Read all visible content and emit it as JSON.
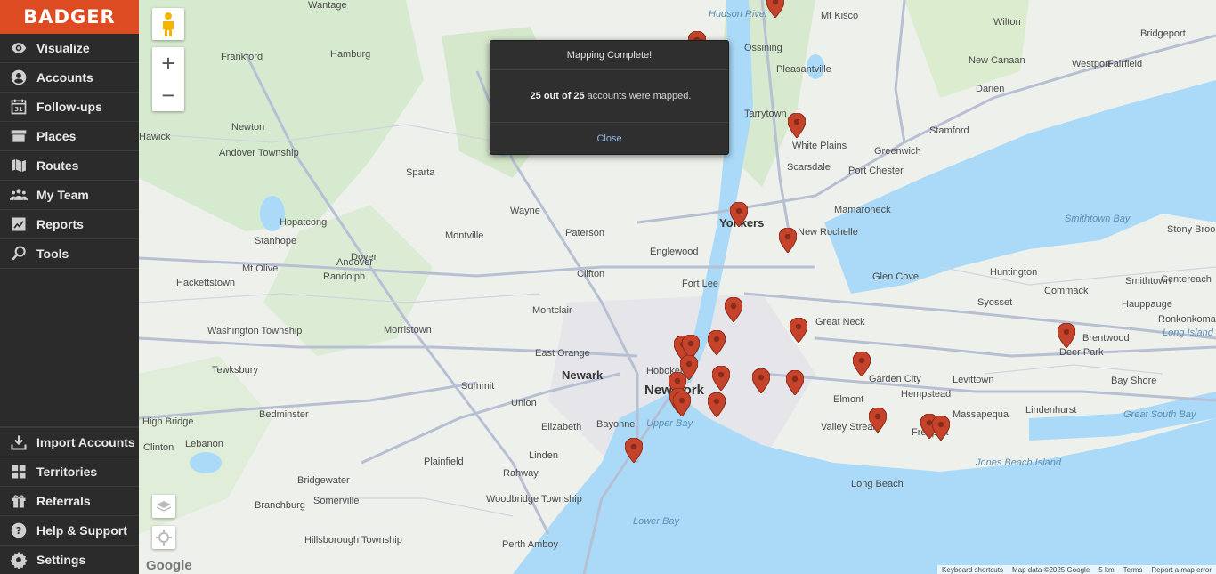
{
  "logo": "BADGER",
  "nav_top": [
    {
      "label": "Visualize",
      "icon": "eye-icon"
    },
    {
      "label": "Accounts",
      "icon": "user-icon"
    },
    {
      "label": "Follow-ups",
      "icon": "calendar-icon"
    },
    {
      "label": "Places",
      "icon": "store-icon"
    },
    {
      "label": "Routes",
      "icon": "map-icon"
    },
    {
      "label": "My Team",
      "icon": "team-icon"
    },
    {
      "label": "Reports",
      "icon": "chart-icon"
    },
    {
      "label": "Tools",
      "icon": "tools-icon"
    }
  ],
  "nav_bottom": [
    {
      "label": "Import Accounts",
      "icon": "import-icon"
    },
    {
      "label": "Territories",
      "icon": "territories-icon"
    },
    {
      "label": "Referrals",
      "icon": "gift-icon"
    },
    {
      "label": "Help & Support",
      "icon": "help-icon"
    },
    {
      "label": "Settings",
      "icon": "gear-icon"
    }
  ],
  "calendar_day": "31",
  "modal": {
    "title": "Mapping Complete!",
    "mapped": "25 out of 25",
    "suffix": "accounts were mapped.",
    "close": "Close"
  },
  "map": {
    "places_big": [
      "New York"
    ],
    "places_med": [
      "Newark",
      "Yonkers"
    ],
    "places": [
      "Wantage",
      "Frankford",
      "Hamburg",
      "Mt Kisco",
      "Wilton",
      "Bridgeport",
      "Ossining",
      "New Canaan",
      "Westport",
      "Fairfield",
      "Pleasantville",
      "Darien",
      "Tarrytown",
      "Stamford",
      "White Plains",
      "Greenwich",
      "Scarsdale",
      "Port Chester",
      "Newton",
      "Andover Township",
      "Sparta",
      "Wayne",
      "Paterson",
      "Hopatcong",
      "Montville",
      "Mamaroneck",
      "New Rochelle",
      "Stanhope",
      "Dover",
      "Englewood",
      "Mt Olive",
      "Randolph",
      "Clifton",
      "Fort Lee",
      "Glen Cove",
      "Huntington",
      "Hackettstown",
      "Syosset",
      "Commack",
      "Smithtown",
      "Hauppauge",
      "Centereach",
      "Ronkonkoma",
      "Washington Township",
      "Morristown",
      "Montclair",
      "Great Neck",
      "East Orange",
      "Hoboken",
      "Brentwood",
      "Deer Park",
      "Garden City",
      "Levittown",
      "Bay Shore",
      "Tewksbury",
      "Summit",
      "Union",
      "Hempstead",
      "Elmont",
      "Lindenhurst",
      "Bedminster",
      "Elizabeth",
      "Valley Stream",
      "Freeport",
      "Massapequa",
      "Bayonne",
      "High Bridge",
      "Clinton",
      "Lebanon",
      "Plainfield",
      "Linden",
      "Rahway",
      "Jones Beach Island",
      "Bridgewater",
      "Long Beach",
      "Branchburg",
      "Somerville",
      "Woodbridge Township",
      "Hillsborough Township",
      "Perth Amboy",
      "Ronkonkoma",
      "Stony Brook",
      "Andover",
      "Hawick"
    ],
    "water": [
      "Smithtown Bay",
      "Great South Bay",
      "Long Island",
      "Lower Bay",
      "Upper Bay",
      "Hudson River"
    ],
    "pins_count": 25
  },
  "footer": [
    "Keyboard shortcuts",
    "Map data ©2025 Google",
    "5 km",
    "Terms",
    "Report a map error"
  ],
  "google_logo": "Google"
}
